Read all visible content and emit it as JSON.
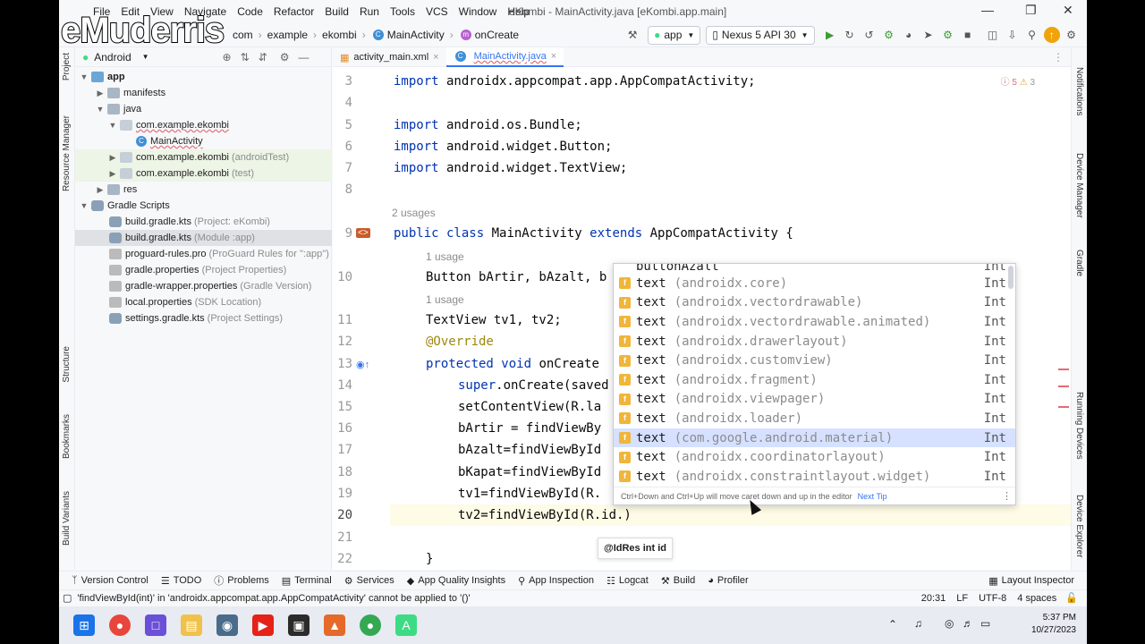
{
  "overlay_logo": "eMuderris",
  "menu": [
    "File",
    "Edit",
    "View",
    "Navigate",
    "Code",
    "Refactor",
    "Build",
    "Run",
    "Tools",
    "VCS",
    "Window",
    "Help"
  ],
  "window_title": "eKombi - MainActivity.java [eKombi.app.main]",
  "breadcrumbs": [
    "com",
    "example",
    "ekombi",
    "MainActivity",
    "onCreate"
  ],
  "run_config": "app",
  "device": "Nexus 5 API 30",
  "left_strip_labels": [
    "Project",
    "Resource Manager",
    "Structure",
    "Bookmarks",
    "Build Variants"
  ],
  "right_strip_labels": [
    "Notifications",
    "Device Manager",
    "Gradle",
    "Running Devices",
    "Device Explorer"
  ],
  "project": {
    "view": "Android",
    "tree": [
      {
        "label": "app",
        "suffix": ""
      },
      {
        "label": "manifests",
        "suffix": ""
      },
      {
        "label": "java",
        "suffix": ""
      },
      {
        "label": "com.example.ekombi",
        "suffix": ""
      },
      {
        "label": "MainActivity",
        "suffix": ""
      },
      {
        "label": "com.example.ekombi",
        "suffix": "(androidTest)"
      },
      {
        "label": "com.example.ekombi",
        "suffix": "(test)"
      },
      {
        "label": "res",
        "suffix": ""
      },
      {
        "label": "Gradle Scripts",
        "suffix": ""
      },
      {
        "label": "build.gradle.kts",
        "suffix": "(Project: eKombi)"
      },
      {
        "label": "build.gradle.kts",
        "suffix": "(Module :app)"
      },
      {
        "label": "proguard-rules.pro",
        "suffix": "(ProGuard Rules for \":app\")"
      },
      {
        "label": "gradle.properties",
        "suffix": "(Project Properties)"
      },
      {
        "label": "gradle-wrapper.properties",
        "suffix": "(Gradle Version)"
      },
      {
        "label": "local.properties",
        "suffix": "(SDK Location)"
      },
      {
        "label": "settings.gradle.kts",
        "suffix": "(Project Settings)"
      }
    ]
  },
  "tabs": [
    "activity_main.xml",
    "MainActivity.java"
  ],
  "inspection": {
    "errors": "5",
    "warnings": "3"
  },
  "line_numbers": [
    "3",
    "4",
    "5",
    "6",
    "7",
    "8",
    "9",
    "10",
    "11",
    "12",
    "13",
    "14",
    "15",
    "16",
    "17",
    "18",
    "19",
    "20",
    "21",
    "22"
  ],
  "code": {
    "l3a": "import",
    "l3b": " androidx.appcompat.app.AppCompatActivity;",
    "l5a": "import",
    "l5b": " android.os.Bundle;",
    "l6a": "import",
    "l6b": " android.widget.Button;",
    "l7a": "import",
    "l7b": " android.widget.TextView;",
    "usages2": "2 usages",
    "l9a": "public class",
    "l9b": " MainActivity ",
    "l9c": "extends",
    "l9d": " AppCompatActivity {",
    "usage1a": "1 usage",
    "l10": "Button bArtir, bAzalt, b",
    "usage1b": "1 usage",
    "l11": "TextView tv1, tv2;",
    "l12": "@Override",
    "l13a": "protected void",
    "l13b": " onCreate",
    "l14a": "super",
    "l14b": ".onCreate(saved",
    "l15": "setContentView(R.la",
    "l16": "bArtir = findViewBy",
    "l17": "bAzalt=findViewById",
    "l18": "bKapat=findViewById",
    "l19": "tv1=findViewById(R.",
    "l20": "tv2=findViewById(R.id.)",
    "l22": "}"
  },
  "completion": {
    "top_partial": "buttonAzalt",
    "items": [
      {
        "name": "text",
        "pkg": "(androidx.core)",
        "type": "Int"
      },
      {
        "name": "text",
        "pkg": "(androidx.vectordrawable)",
        "type": "Int"
      },
      {
        "name": "text",
        "pkg": "(androidx.vectordrawable.animated)",
        "type": "Int"
      },
      {
        "name": "text",
        "pkg": "(androidx.drawerlayout)",
        "type": "Int"
      },
      {
        "name": "text",
        "pkg": "(androidx.customview)",
        "type": "Int"
      },
      {
        "name": "text",
        "pkg": "(androidx.fragment)",
        "type": "Int"
      },
      {
        "name": "text",
        "pkg": "(androidx.viewpager)",
        "type": "Int"
      },
      {
        "name": "text",
        "pkg": "(androidx.loader)",
        "type": "Int"
      },
      {
        "name": "text",
        "pkg": "(com.google.android.material)",
        "type": "Int"
      },
      {
        "name": "text",
        "pkg": "(androidx.coordinatorlayout)",
        "type": "Int"
      },
      {
        "name": "text",
        "pkg": "(androidx.constraintlayout.widget)",
        "type": "Int"
      }
    ],
    "selected_index": 8,
    "footer": "Ctrl+Down and Ctrl+Up will move caret down and up in the editor",
    "footer_link": "Next Tip"
  },
  "param_hint": "@IdRes int id",
  "toolwindows": [
    "Version Control",
    "TODO",
    "Problems",
    "Terminal",
    "Services",
    "App Quality Insights",
    "App Inspection",
    "Logcat",
    "Build",
    "Profiler"
  ],
  "layout_inspector": "Layout Inspector",
  "status": {
    "message": "'findViewById(int)' in 'androidx.appcompat.app.AppCompatActivity' cannot be applied to '()'",
    "position": "20:31",
    "line_sep": "LF",
    "encoding": "UTF-8",
    "indent": "4 spaces"
  },
  "clock": {
    "time": "5:37 PM",
    "date": "10/27/2023"
  }
}
